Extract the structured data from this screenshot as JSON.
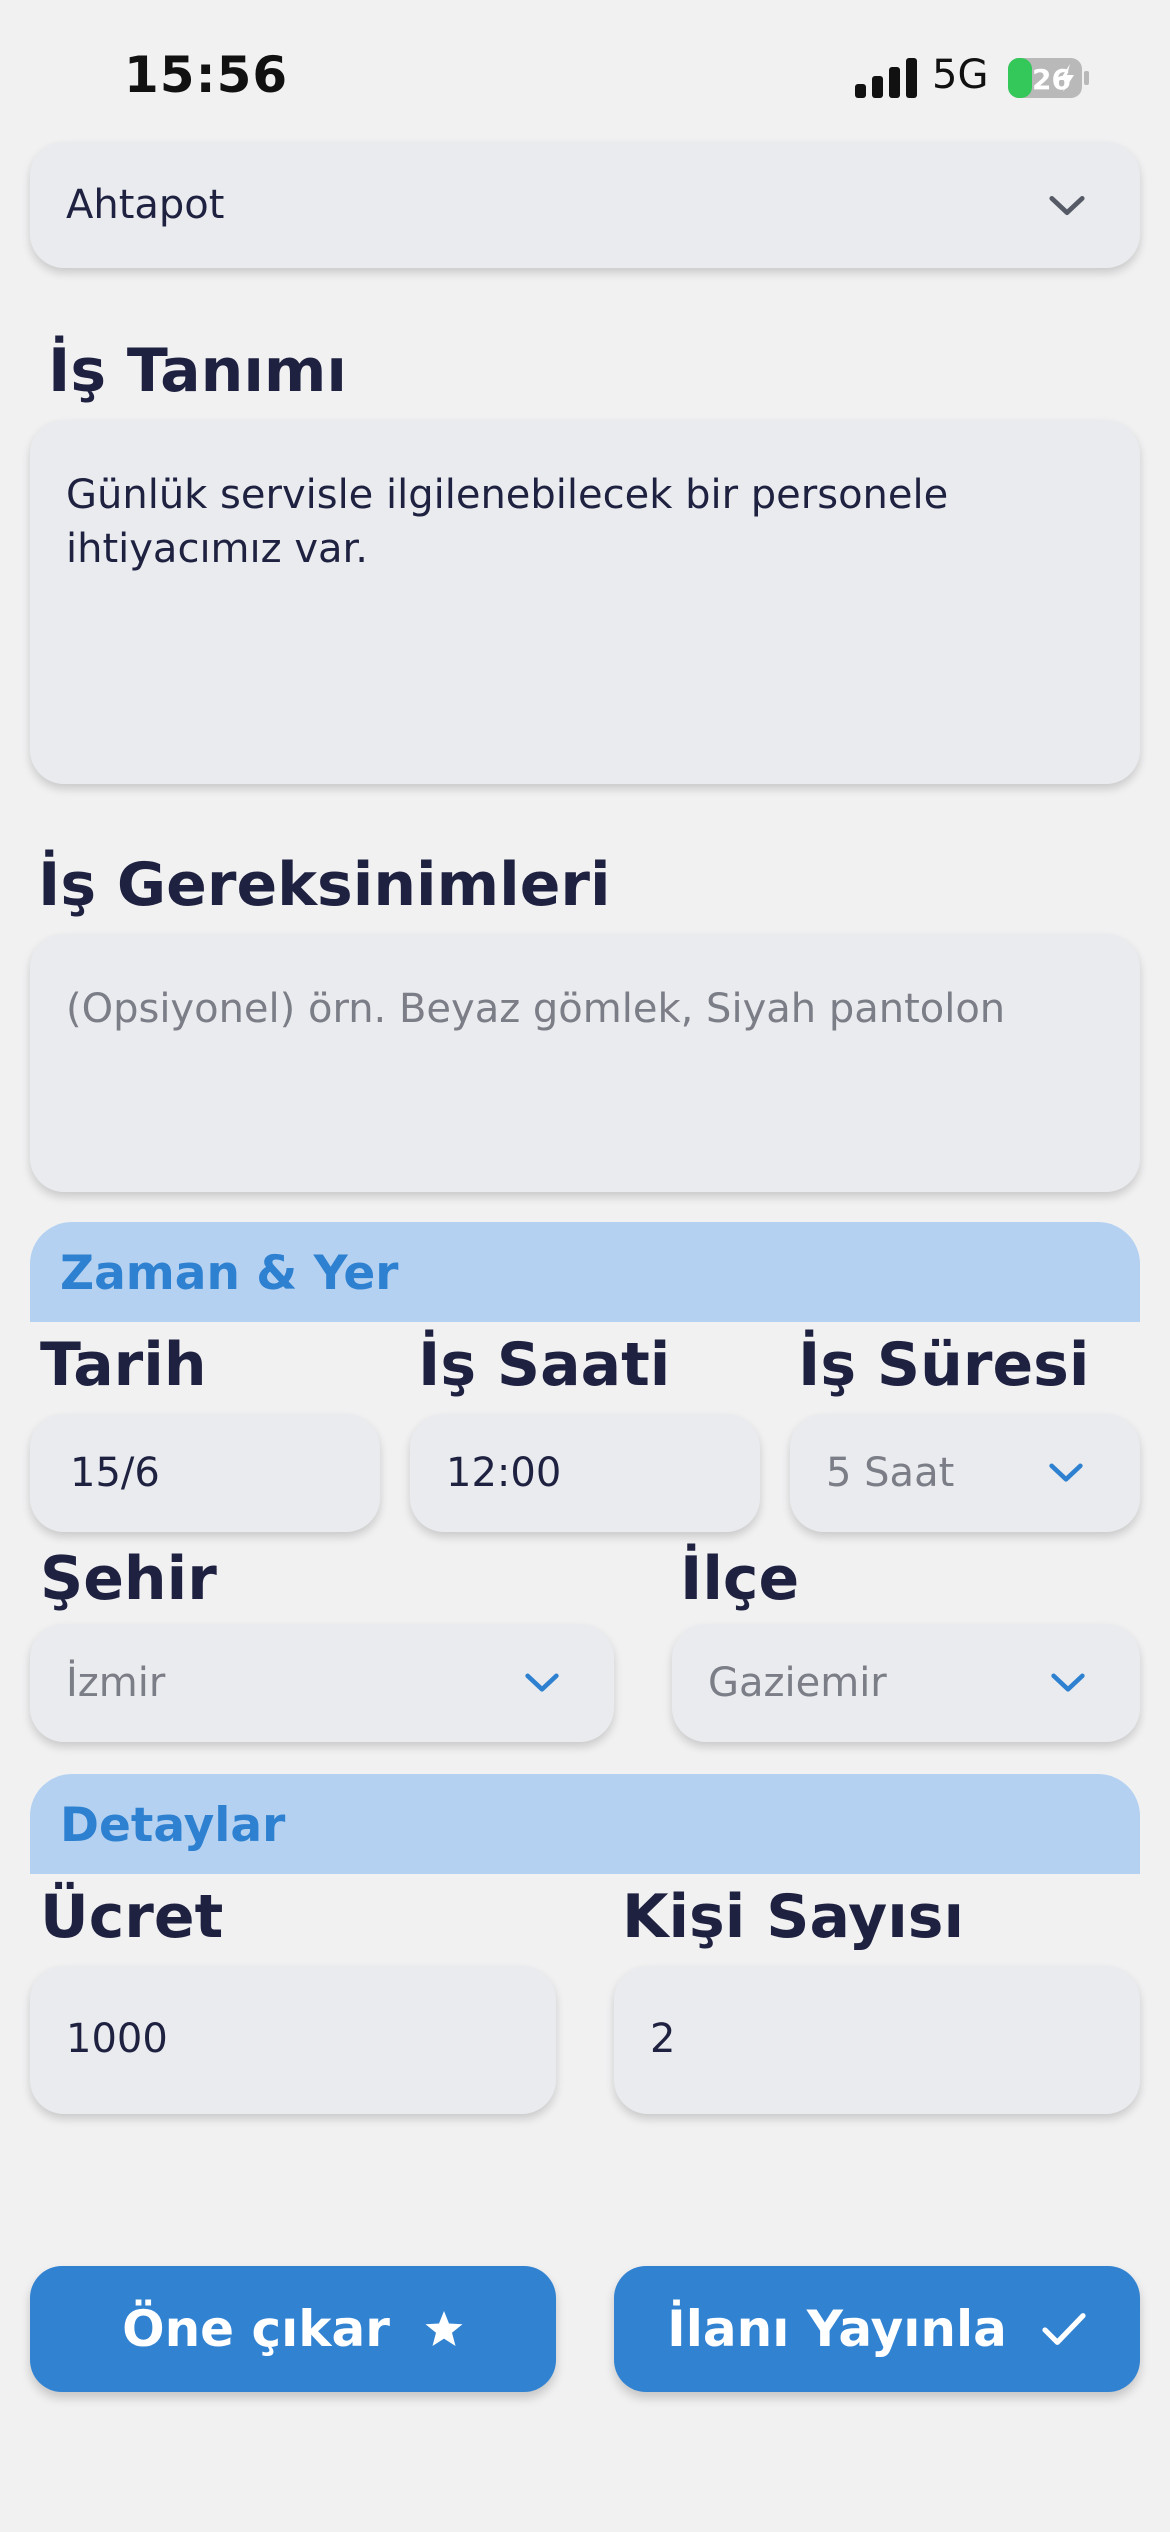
{
  "status_bar": {
    "time": "15:56",
    "network": "5G",
    "battery": "26"
  },
  "category_select": {
    "value": "Ahtapot"
  },
  "job_description": {
    "heading": "İş Tanımı",
    "value": "Günlük servisle ilgilenebilecek bir personele ihtiyacımız var."
  },
  "job_requirements": {
    "heading": "İş Gereksinimleri",
    "placeholder": "(Opsiyonel) örn. Beyaz gömlek, Siyah pantolon"
  },
  "time_place": {
    "title": "Zaman & Yer",
    "date": {
      "label": "Tarih",
      "value": "15/6"
    },
    "hour": {
      "label": "İş Saati",
      "value": "12:00"
    },
    "duration": {
      "label": "İş Süresi",
      "value": "5 Saat"
    },
    "city": {
      "label": "Şehir",
      "value": "İzmir"
    },
    "district": {
      "label": "İlçe",
      "value": "Gaziemir"
    }
  },
  "details": {
    "title": "Detaylar",
    "fee": {
      "label": "Ücret",
      "value": "1000"
    },
    "headcount": {
      "label": "Kişi Sayısı",
      "value": "2"
    }
  },
  "actions": {
    "feature_label": "Öne çıkar",
    "publish_label": "İlanı Yayınla"
  },
  "colors": {
    "accent": "#3183d2",
    "section_bg": "#b4d1f1",
    "field_bg": "#e9ebee",
    "page_bg": "#f1f1f2"
  }
}
